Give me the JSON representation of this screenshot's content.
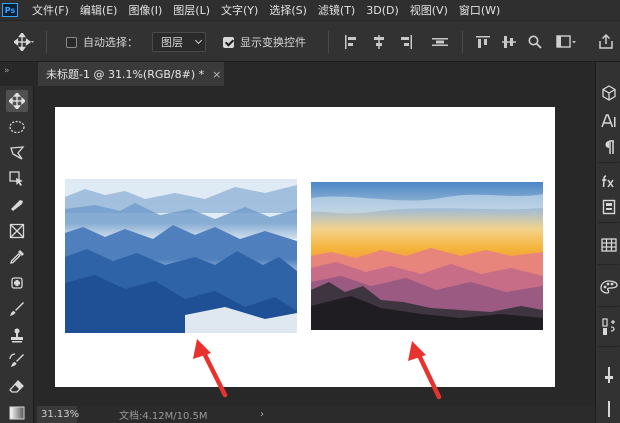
{
  "app": {
    "logo": "Ps"
  },
  "menu": [
    "文件(F)",
    "编辑(E)",
    "图像(I)",
    "图层(L)",
    "文字(Y)",
    "选择(S)",
    "滤镜(T)",
    "3D(D)",
    "视图(V)",
    "窗口(W)"
  ],
  "options": {
    "auto_select_label": "自动选择：",
    "auto_select_checked": false,
    "layer_select_value": "图层",
    "show_transform_label": "显示变换控件",
    "show_transform_checked": true
  },
  "document_tab": {
    "title": "未标题-1 @ 31.1%(RGB/8#) *",
    "close": "×"
  },
  "panel_collapse": {
    "left": "»",
    "right": "«"
  },
  "status": {
    "zoom": "31.13%",
    "doc_info": "文档:4.12M/10.5M",
    "more": "›"
  },
  "right_panel_icons": [
    "3d-cube-icon",
    "character-icon",
    "paragraph-icon",
    "fx-icon",
    "properties-icon",
    "swatches-icon",
    "styles-icon",
    "layers-icon",
    "adjust-icon",
    "info-icon"
  ],
  "tools": [
    "move-tool-icon",
    "marquee-tool-icon",
    "lasso-tool-icon",
    "object-select-tool-icon",
    "crop-tool-icon",
    "frame-tool-icon",
    "eyedropper-tool-icon",
    "healing-tool-icon",
    "brush-tool-icon",
    "stamp-tool-icon",
    "history-brush-tool-icon",
    "eraser-tool-icon",
    "gradient-tool-icon"
  ],
  "colors": {
    "accent_arrow": "#e8322e",
    "ps_blue": "#31a8ff",
    "ui_dark": "#323232"
  }
}
